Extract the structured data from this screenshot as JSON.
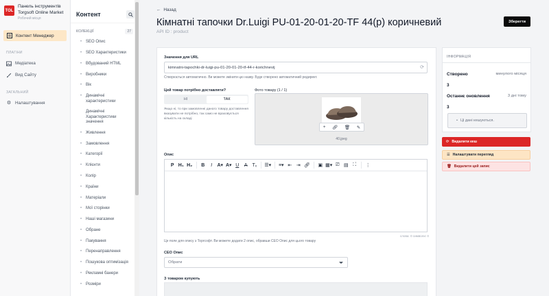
{
  "brand": {
    "logo_text": "TOL",
    "title_line1": "Панель інструментів",
    "title_line2": "Torgsoft Online Market",
    "subtitle": "Робочий місця"
  },
  "sidebar": {
    "active_item": "Контент Менеджер",
    "section_plugins": "ПЛАГІНИ",
    "plugins": [
      "Медіатека",
      "Вид Сайту"
    ],
    "section_general": "ЗАГАЛЬНИЙ",
    "general": [
      "Налаштування"
    ]
  },
  "tree": {
    "title": "Контент",
    "group_label": "КОЛЕКЦІЇ",
    "group_count": "27",
    "items": [
      "SEO Опис",
      "SEO Характеристики",
      "Вбудований HTML",
      "Виробники",
      "Вік",
      "Динамічні характеристики",
      "Динамічні Характеристики значення",
      "Живлення",
      "Замовлення",
      "Категорії",
      "Клієнти",
      "Колір",
      "Країни",
      "Матеріали",
      "Мої сторінки",
      "Наші магазини",
      "Обране",
      "Пакування",
      "Перенаправлення",
      "Пошукова оптимізація",
      "Рекламні банери",
      "Розміри"
    ]
  },
  "header": {
    "back_label": "Назад",
    "title": "Кімнатні тапочки Dr.Luigi PU-01-20-01-20-TF 44(р) коричневий",
    "api_id": "API ID : product",
    "save_label": "Зберегти"
  },
  "form": {
    "url_label": "Значення для URL",
    "url_value": "kimnatni-tapochki-dr-luigi-pu-01-20-01-20-tf-44-r-korichnevij",
    "url_help": "Створюється автоматично. Ви можете змінити цю назву. Буде створено автоматичний редирект.",
    "delivery_label": "Цей товар потрібно доставляти?",
    "toggle_no": "НІ",
    "toggle_yes": "ТАК",
    "delivery_help": "Якщо ні, то при замовленні даного товару доставлення вказувати не потрібно, так само не враховується кількість на складі",
    "photo_label": "Фото товару (1 / 1)",
    "photo_name": "40.jpeg",
    "description_label": "Опис",
    "counter": "слова: 0  символи: 0",
    "description_help": "Це поле для опису з Торгсофт. Ви можете додати 2 опис, обравши СЕО Опис для цього товару",
    "seo_label": "СЕО Опис",
    "seo_placeholder": "Обрати",
    "related_label": "З товаром купують"
  },
  "info": {
    "title": "ІНФОРМАЦІЯ",
    "created_key": "Створено",
    "created_val": "минулого місяця",
    "created_num": "3",
    "updated_key": "Останнє оновлення",
    "updated_val": "3 дні тому",
    "updated_num": "3",
    "cache_text": "Ці дані кешуються."
  },
  "actions": {
    "clear_cache": "Видалити кеш",
    "setup_view": "Налаштувати перегляд",
    "delete_entry": "Видалити цей запис"
  },
  "colors": {
    "accent": "#fde7c7",
    "danger": "#dc2626",
    "primary_button": "#0a0a0a"
  }
}
